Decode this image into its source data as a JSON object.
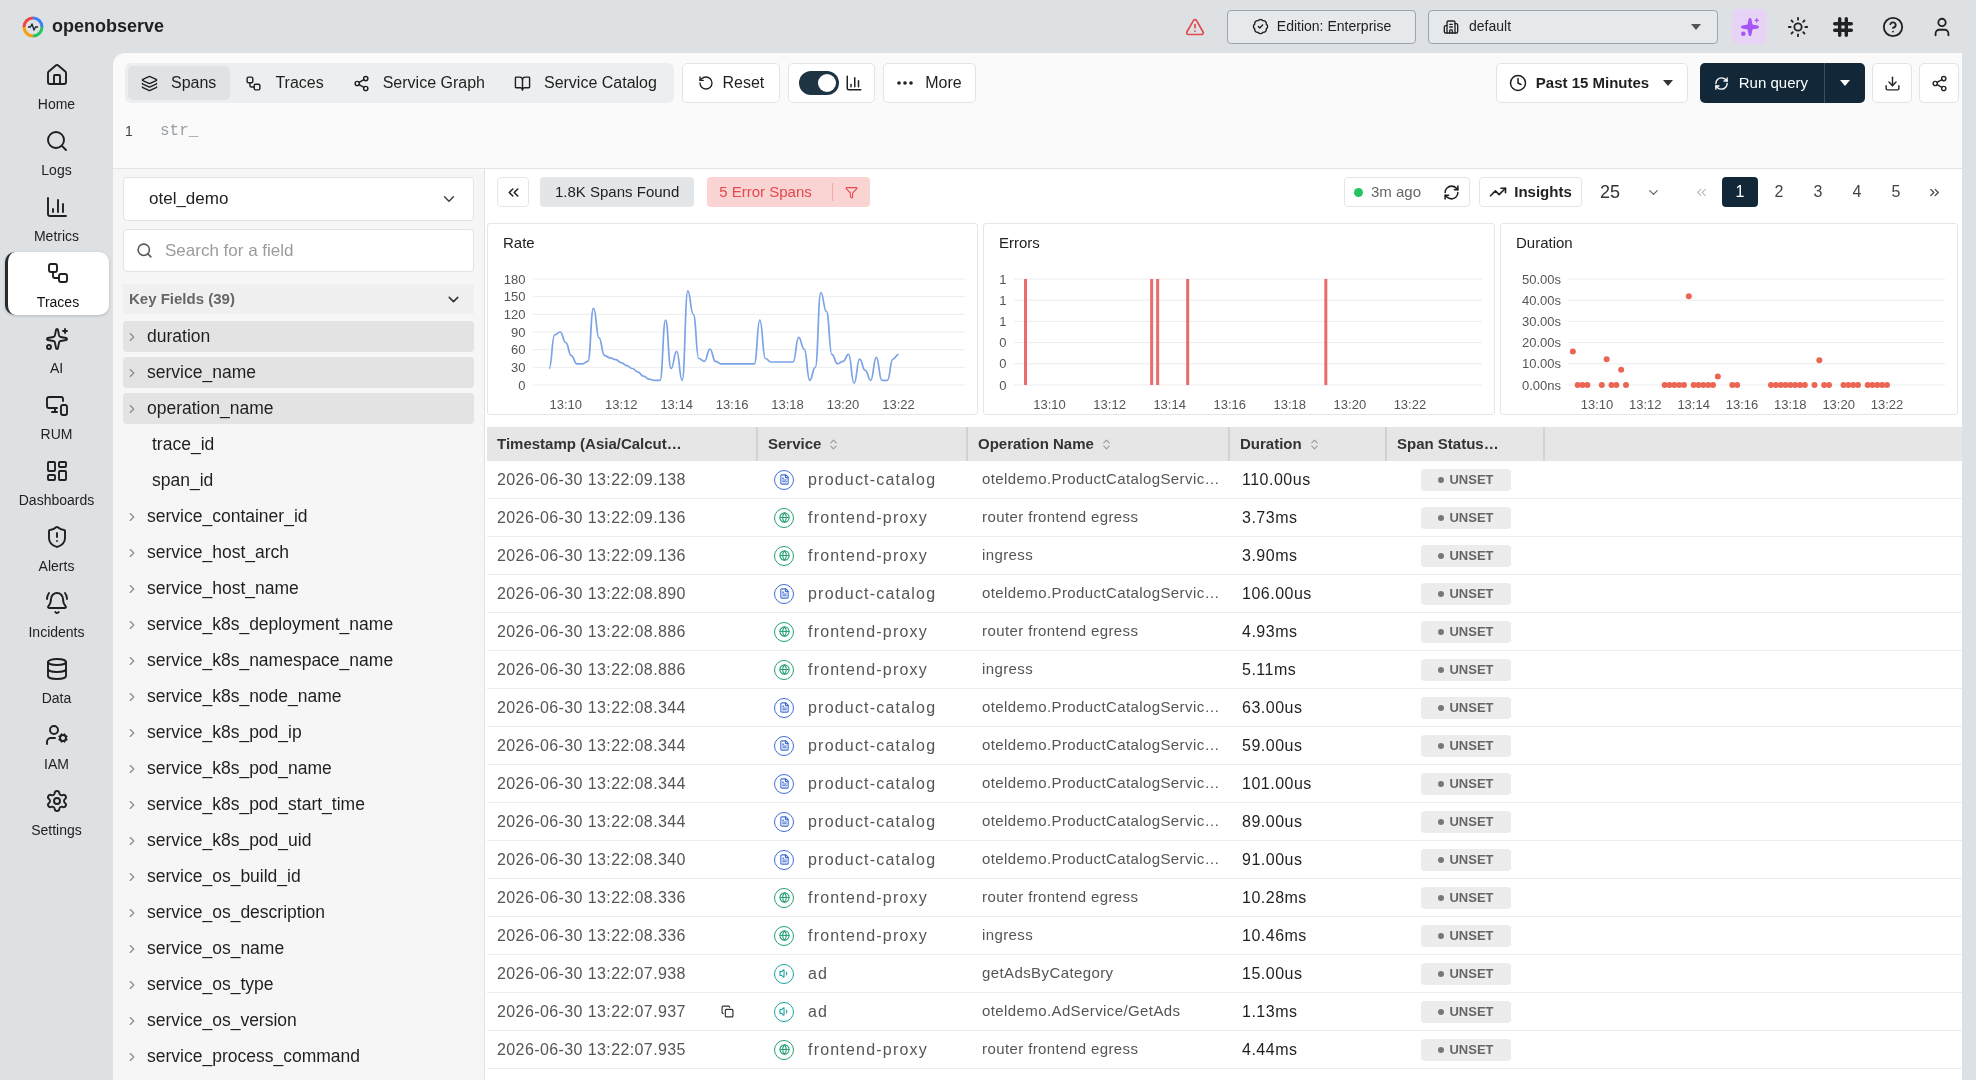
{
  "top_bar": {
    "app_name": "openobserve",
    "edition": "Edition: Enterprise",
    "organization": "default"
  },
  "nav": [
    {
      "label": "Home",
      "selected": false
    },
    {
      "label": "Logs",
      "selected": false
    },
    {
      "label": "Metrics",
      "selected": false
    },
    {
      "label": "Traces",
      "selected": true
    },
    {
      "label": "AI",
      "selected": false
    },
    {
      "label": "RUM",
      "selected": false
    },
    {
      "label": "Dashboards",
      "selected": false
    },
    {
      "label": "Alerts",
      "selected": false
    },
    {
      "label": "Incidents",
      "selected": false
    },
    {
      "label": "Data",
      "selected": false
    },
    {
      "label": "IAM",
      "selected": false
    },
    {
      "label": "Settings",
      "selected": false
    }
  ],
  "toolbar": {
    "tabs": [
      {
        "label": "Spans",
        "selected": true
      },
      {
        "label": "Traces",
        "selected": false
      },
      {
        "label": "Service Graph",
        "selected": false
      },
      {
        "label": "Service Catalog",
        "selected": false
      }
    ],
    "reset": "Reset",
    "chart_toggle": {
      "on": true
    },
    "more": "More",
    "time_range": "Past 15 Minutes",
    "run_query": "Run query"
  },
  "query_editor": {
    "line_number": "1",
    "text": "str_"
  },
  "field_panel": {
    "stream": "otel_demo",
    "search": {
      "placeholder": "Search for a field"
    },
    "group": {
      "title": "Key Fields (39)",
      "expanded": true,
      "fields": [
        {
          "name": "duration",
          "selected": true,
          "expandable": true
        },
        {
          "name": "service_name",
          "selected": true,
          "expandable": true
        },
        {
          "name": "operation_name",
          "selected": true,
          "expandable": true
        },
        {
          "name": "trace_id",
          "selected": false,
          "expandable": false
        },
        {
          "name": "span_id",
          "selected": false,
          "expandable": false
        },
        {
          "name": "service_container_id",
          "selected": false,
          "expandable": true
        },
        {
          "name": "service_host_arch",
          "selected": false,
          "expandable": true
        },
        {
          "name": "service_host_name",
          "selected": false,
          "expandable": true
        },
        {
          "name": "service_k8s_deployment_name",
          "selected": false,
          "expandable": true
        },
        {
          "name": "service_k8s_namespace_name",
          "selected": false,
          "expandable": true
        },
        {
          "name": "service_k8s_node_name",
          "selected": false,
          "expandable": true
        },
        {
          "name": "service_k8s_pod_ip",
          "selected": false,
          "expandable": true
        },
        {
          "name": "service_k8s_pod_name",
          "selected": false,
          "expandable": true
        },
        {
          "name": "service_k8s_pod_start_time",
          "selected": false,
          "expandable": true
        },
        {
          "name": "service_k8s_pod_uid",
          "selected": false,
          "expandable": true
        },
        {
          "name": "service_os_build_id",
          "selected": false,
          "expandable": true
        },
        {
          "name": "service_os_description",
          "selected": false,
          "expandable": true
        },
        {
          "name": "service_os_name",
          "selected": false,
          "expandable": true
        },
        {
          "name": "service_os_type",
          "selected": false,
          "expandable": true
        },
        {
          "name": "service_os_version",
          "selected": false,
          "expandable": true
        },
        {
          "name": "service_process_command",
          "selected": false,
          "expandable": true
        }
      ]
    }
  },
  "results_bar": {
    "spans_found": "1.8K Spans Found",
    "error_spans": "5 Error Spans",
    "refreshed": "3m ago",
    "insights": "Insights",
    "page_size": "25",
    "pages": [
      {
        "label": "1",
        "selected": true
      },
      {
        "label": "2",
        "selected": false
      },
      {
        "label": "3",
        "selected": false
      },
      {
        "label": "4",
        "selected": false
      },
      {
        "label": "5",
        "selected": false
      }
    ]
  },
  "charts": [
    {
      "chart_data": {
        "type": "line",
        "title": "Rate",
        "grid": true,
        "categories": [
          null,
          null,
          null,
          null,
          null,
          null,
          "13:10",
          null,
          null,
          null,
          null,
          null,
          null,
          null,
          null,
          null,
          "13:12",
          null,
          null,
          null,
          null,
          null,
          null,
          null,
          null,
          null,
          "13:14",
          null,
          null,
          null,
          null,
          null,
          null,
          null,
          null,
          null,
          "13:16",
          null,
          null,
          null,
          null,
          null,
          null,
          null,
          null,
          null,
          "13:18",
          null,
          null,
          null,
          null,
          null,
          null,
          null,
          null,
          null,
          "13:20",
          null,
          null,
          null,
          null,
          null,
          null,
          null,
          null,
          null,
          "13:22",
          null,
          null,
          null,
          null,
          null,
          null,
          null,
          null,
          null,
          null,
          null,
          null
        ],
        "values": [
          null,
          null,
          null,
          28,
          85,
          90,
          72,
          50,
          36,
          36,
          40,
          130,
          80,
          50,
          46,
          43,
          38,
          33,
          28,
          22,
          15,
          10,
          8,
          8,
          110,
          28,
          57,
          8,
          160,
          120,
          45,
          40,
          61,
          40,
          36,
          36,
          36,
          36,
          36,
          36,
          36,
          110,
          45,
          39,
          39,
          39,
          39,
          39,
          81,
          61,
          8,
          30,
          157,
          125,
          52,
          36,
          40,
          52,
          3,
          44,
          25,
          8,
          47,
          8,
          8,
          44,
          52,
          null,
          null,
          null,
          null,
          null,
          null,
          null,
          null,
          null,
          null,
          null,
          null
        ],
        "ylim": [
          0,
          180
        ],
        "yticks": [
          0,
          30,
          60,
          90,
          120,
          150,
          180
        ]
      }
    },
    {
      "chart_data": {
        "type": "bar",
        "title": "Errors",
        "grid": true,
        "categories": [
          null,
          null,
          null,
          null,
          null,
          null,
          "13:10",
          null,
          null,
          null,
          null,
          null,
          null,
          null,
          null,
          null,
          "13:12",
          null,
          null,
          null,
          null,
          null,
          null,
          null,
          null,
          null,
          "13:14",
          null,
          null,
          null,
          null,
          null,
          null,
          null,
          null,
          null,
          "13:16",
          null,
          null,
          null,
          null,
          null,
          null,
          null,
          null,
          null,
          "13:18",
          null,
          null,
          null,
          null,
          null,
          null,
          null,
          null,
          null,
          "13:20",
          null,
          null,
          null,
          null,
          null,
          null,
          null,
          null,
          null,
          "13:22",
          null,
          null,
          null,
          null,
          null,
          null,
          null,
          null,
          null,
          null,
          null,
          null
        ],
        "values": [
          null,
          null,
          1,
          null,
          null,
          null,
          null,
          null,
          null,
          null,
          null,
          null,
          null,
          null,
          null,
          null,
          null,
          null,
          null,
          null,
          null,
          null,
          null,
          1,
          1,
          null,
          null,
          null,
          null,
          1,
          null,
          null,
          null,
          null,
          null,
          null,
          null,
          null,
          null,
          null,
          null,
          null,
          null,
          null,
          null,
          null,
          null,
          null,
          null,
          null,
          null,
          null,
          1,
          null,
          null,
          null,
          null,
          null,
          null,
          null,
          null,
          null,
          null,
          null,
          null,
          null,
          null,
          null,
          null,
          null,
          null,
          null,
          null,
          null,
          null,
          null,
          null,
          null,
          null
        ],
        "ylim": [
          0,
          1
        ],
        "yticks": [
          {
            "value": 0,
            "label": "0"
          },
          {
            "value": 0.2,
            "label": "0"
          },
          {
            "value": 0.4,
            "label": "0"
          },
          {
            "value": 0.6,
            "label": "1"
          },
          {
            "value": 0.8,
            "label": "1"
          },
          {
            "value": 1,
            "label": "1"
          }
        ]
      }
    },
    {
      "chart_data": {
        "type": "scatter",
        "title": "Duration",
        "grid": true,
        "categories": [
          null,
          null,
          null,
          null,
          null,
          null,
          "13:10",
          null,
          null,
          null,
          null,
          null,
          null,
          null,
          null,
          null,
          "13:12",
          null,
          null,
          null,
          null,
          null,
          null,
          null,
          null,
          null,
          "13:14",
          null,
          null,
          null,
          null,
          null,
          null,
          null,
          null,
          null,
          "13:16",
          null,
          null,
          null,
          null,
          null,
          null,
          null,
          null,
          null,
          "13:18",
          null,
          null,
          null,
          null,
          null,
          null,
          null,
          null,
          null,
          "13:20",
          null,
          null,
          null,
          null,
          null,
          null,
          null,
          null,
          null,
          "13:22",
          null,
          null,
          null,
          null,
          null,
          null,
          null,
          null,
          null,
          null,
          null,
          null
        ],
        "values": [
          null,
          15.8,
          0,
          0,
          0,
          null,
          null,
          0,
          12.2,
          0,
          0,
          7.2,
          0,
          null,
          null,
          null,
          null,
          null,
          null,
          null,
          0,
          0,
          0,
          0,
          0,
          41.9,
          0,
          0,
          0,
          0,
          0,
          4,
          null,
          null,
          0,
          0,
          null,
          null,
          null,
          null,
          null,
          null,
          0,
          0,
          0,
          0,
          0,
          0,
          0,
          0,
          null,
          0,
          11.7,
          0,
          0,
          null,
          null,
          0,
          0,
          0,
          0,
          null,
          0,
          0,
          0,
          0,
          0,
          null,
          null,
          null,
          null,
          null,
          null,
          null,
          null,
          null,
          null,
          null,
          null
        ],
        "ylim": [
          0,
          50
        ],
        "yticks": [
          {
            "value": 0,
            "label": "0.00ns"
          },
          {
            "value": 10,
            "label": "10.00s"
          },
          {
            "value": 20,
            "label": "20.00s"
          },
          {
            "value": 30,
            "label": "30.00s"
          },
          {
            "value": 40,
            "label": "40.00s"
          },
          {
            "value": 50,
            "label": "50.00s"
          }
        ]
      }
    }
  ],
  "table": {
    "columns": [
      {
        "label": "Timestamp (Asia/Calcut…",
        "sortable": false
      },
      {
        "label": "Service",
        "sortable": true
      },
      {
        "label": "Operation Name",
        "sortable": true
      },
      {
        "label": "Duration",
        "sortable": true
      },
      {
        "label": "Span Status…",
        "sortable": false
      }
    ],
    "rows": [
      {
        "timestamp": "2026-06-30 13:22:09.138",
        "service": {
          "name": "product-catalog",
          "kind": "catalog",
          "color": "#3f6fd5"
        },
        "operation": "oteldemo.ProductCatalogServic…",
        "duration": "110.00us",
        "status": "UNSET",
        "hovered": false
      },
      {
        "timestamp": "2026-06-30 13:22:09.136",
        "service": {
          "name": "frontend-proxy",
          "kind": "proxy",
          "color": "#24a271"
        },
        "operation": "router frontend egress",
        "duration": "3.73ms",
        "status": "UNSET",
        "hovered": false
      },
      {
        "timestamp": "2026-06-30 13:22:09.136",
        "service": {
          "name": "frontend-proxy",
          "kind": "proxy",
          "color": "#24a271"
        },
        "operation": "ingress",
        "duration": "3.90ms",
        "status": "UNSET",
        "hovered": false
      },
      {
        "timestamp": "2026-06-30 13:22:08.890",
        "service": {
          "name": "product-catalog",
          "kind": "catalog",
          "color": "#3f6fd5"
        },
        "operation": "oteldemo.ProductCatalogServic…",
        "duration": "106.00us",
        "status": "UNSET",
        "hovered": false
      },
      {
        "timestamp": "2026-06-30 13:22:08.886",
        "service": {
          "name": "frontend-proxy",
          "kind": "proxy",
          "color": "#24a271"
        },
        "operation": "router frontend egress",
        "duration": "4.93ms",
        "status": "UNSET",
        "hovered": false
      },
      {
        "timestamp": "2026-06-30 13:22:08.886",
        "service": {
          "name": "frontend-proxy",
          "kind": "proxy",
          "color": "#24a271"
        },
        "operation": "ingress",
        "duration": "5.11ms",
        "status": "UNSET",
        "hovered": false
      },
      {
        "timestamp": "2026-06-30 13:22:08.344",
        "service": {
          "name": "product-catalog",
          "kind": "catalog",
          "color": "#3f6fd5"
        },
        "operation": "oteldemo.ProductCatalogServic…",
        "duration": "63.00us",
        "status": "UNSET",
        "hovered": false
      },
      {
        "timestamp": "2026-06-30 13:22:08.344",
        "service": {
          "name": "product-catalog",
          "kind": "catalog",
          "color": "#3f6fd5"
        },
        "operation": "oteldemo.ProductCatalogServic…",
        "duration": "59.00us",
        "status": "UNSET",
        "hovered": false
      },
      {
        "timestamp": "2026-06-30 13:22:08.344",
        "service": {
          "name": "product-catalog",
          "kind": "catalog",
          "color": "#3f6fd5"
        },
        "operation": "oteldemo.ProductCatalogServic…",
        "duration": "101.00us",
        "status": "UNSET",
        "hovered": false
      },
      {
        "timestamp": "2026-06-30 13:22:08.344",
        "service": {
          "name": "product-catalog",
          "kind": "catalog",
          "color": "#3f6fd5"
        },
        "operation": "oteldemo.ProductCatalogServic…",
        "duration": "89.00us",
        "status": "UNSET",
        "hovered": false
      },
      {
        "timestamp": "2026-06-30 13:22:08.340",
        "service": {
          "name": "product-catalog",
          "kind": "catalog",
          "color": "#3f6fd5"
        },
        "operation": "oteldemo.ProductCatalogServic…",
        "duration": "91.00us",
        "status": "UNSET",
        "hovered": false
      },
      {
        "timestamp": "2026-06-30 13:22:08.336",
        "service": {
          "name": "frontend-proxy",
          "kind": "proxy",
          "color": "#24a271"
        },
        "operation": "router frontend egress",
        "duration": "10.28ms",
        "status": "UNSET",
        "hovered": false
      },
      {
        "timestamp": "2026-06-30 13:22:08.336",
        "service": {
          "name": "frontend-proxy",
          "kind": "proxy",
          "color": "#24a271"
        },
        "operation": "ingress",
        "duration": "10.46ms",
        "status": "UNSET",
        "hovered": false
      },
      {
        "timestamp": "2026-06-30 13:22:07.938",
        "service": {
          "name": "ad",
          "kind": "media",
          "color": "#1ba3a6"
        },
        "operation": "getAdsByCategory",
        "duration": "15.00us",
        "status": "UNSET",
        "hovered": false
      },
      {
        "timestamp": "2026-06-30 13:22:07.937",
        "service": {
          "name": "ad",
          "kind": "media",
          "color": "#1ba3a6"
        },
        "operation": "oteldemo.AdService/GetAds",
        "duration": "1.13ms",
        "status": "UNSET",
        "hovered": true
      },
      {
        "timestamp": "2026-06-30 13:22:07.935",
        "service": {
          "name": "frontend-proxy",
          "kind": "proxy",
          "color": "#24a271"
        },
        "operation": "router frontend egress",
        "duration": "4.44ms",
        "status": "UNSET",
        "hovered": false
      }
    ]
  }
}
